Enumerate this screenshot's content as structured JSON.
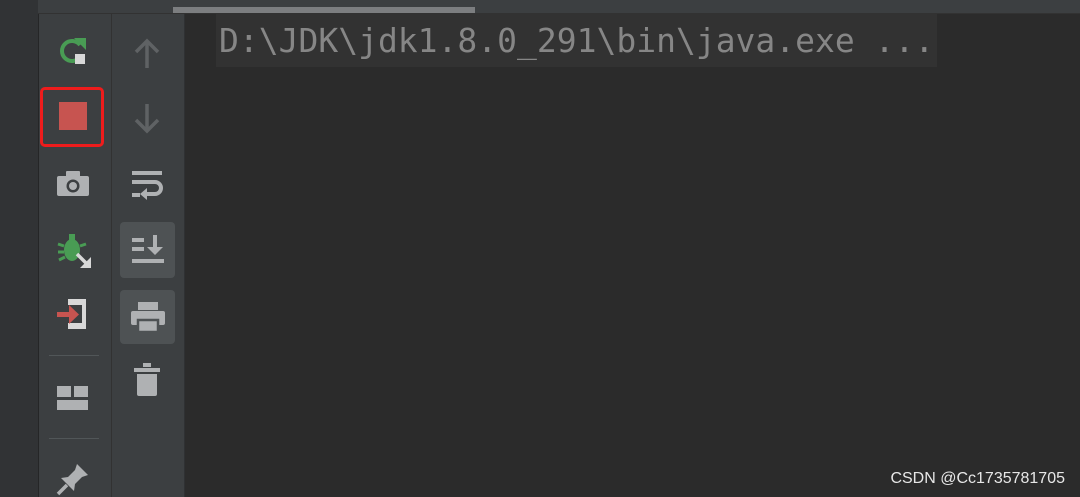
{
  "console": {
    "command_line": "D:\\JDK\\jdk1.8.0_291\\bin\\java.exe ..."
  },
  "toolbar_left": {
    "buttons": [
      {
        "name": "rerun",
        "icon": "rerun-icon",
        "color": "#499c54"
      },
      {
        "name": "stop",
        "icon": "stop-icon",
        "color": "#c75450",
        "highlighted": true
      },
      {
        "name": "dump-threads",
        "icon": "camera-icon",
        "color": "#afb1b3"
      },
      {
        "name": "attach-debugger",
        "icon": "bug-icon",
        "color": "#499c54"
      },
      {
        "name": "exit",
        "icon": "exit-icon",
        "color": "#c75450"
      },
      {
        "name": "restore-layout",
        "icon": "layout-icon",
        "color": "#afb1b3"
      },
      {
        "name": "pin-tab",
        "icon": "pin-icon",
        "color": "#afb1b3"
      }
    ]
  },
  "toolbar_right": {
    "buttons": [
      {
        "name": "up-stack-trace",
        "icon": "arrow-up-icon",
        "enabled": false
      },
      {
        "name": "down-stack-trace",
        "icon": "arrow-down-icon",
        "enabled": false
      },
      {
        "name": "soft-wrap",
        "icon": "soft-wrap-icon",
        "enabled": true
      },
      {
        "name": "scroll-to-end",
        "icon": "scroll-to-end-icon",
        "toggled": true
      },
      {
        "name": "print",
        "icon": "print-icon",
        "toggled": true
      },
      {
        "name": "clear-all",
        "icon": "trash-icon",
        "enabled": true
      }
    ]
  },
  "highlight_color": "#ee1c1c",
  "watermark": {
    "text": "CSDN @Cc1735781705"
  }
}
